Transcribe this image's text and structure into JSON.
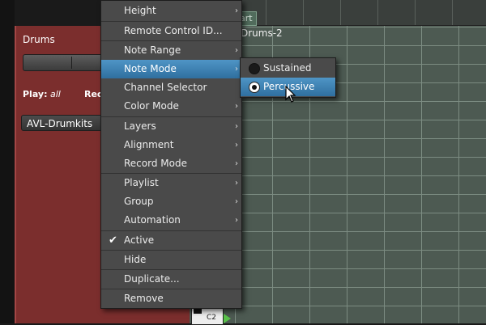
{
  "track": {
    "name": "Drums",
    "play_key": "Play:",
    "play_value": "all",
    "rec_label": "Rec",
    "drumkit": "AVL-Drumkits",
    "region_label": "Drums-2",
    "marker_label": "art",
    "mini_note": "C2"
  },
  "context_menu": {
    "items": [
      {
        "label": "Height",
        "submenu": true
      },
      {
        "label": "Remote Control ID...",
        "submenu": false
      },
      {
        "label": "Note Range",
        "submenu": true
      },
      {
        "label": "Note Mode",
        "submenu": true,
        "highlighted": true
      },
      {
        "label": "Channel Selector",
        "submenu": false
      },
      {
        "label": "Color Mode",
        "submenu": true
      },
      {
        "label": "Layers",
        "submenu": true
      },
      {
        "label": "Alignment",
        "submenu": true
      },
      {
        "label": "Record Mode",
        "submenu": true
      },
      {
        "label": "Playlist",
        "submenu": true
      },
      {
        "label": "Group",
        "submenu": true
      },
      {
        "label": "Automation",
        "submenu": true
      },
      {
        "label": "Active",
        "submenu": false,
        "checked": true
      },
      {
        "label": "Hide",
        "submenu": false
      },
      {
        "label": "Duplicate...",
        "submenu": false
      },
      {
        "label": "Remove",
        "submenu": false
      }
    ],
    "arrow_glyph": "›",
    "check_glyph": "✔"
  },
  "note_mode_submenu": {
    "items": [
      {
        "label": "Sustained",
        "selected": false
      },
      {
        "label": "Percussive",
        "selected": true,
        "highlighted": true
      }
    ]
  },
  "colors": {
    "menu_bg": "#4a4a4a",
    "highlight": "#3b80b4",
    "track_header": "#7b2e2d",
    "grid_bg": "#4d5a52"
  }
}
